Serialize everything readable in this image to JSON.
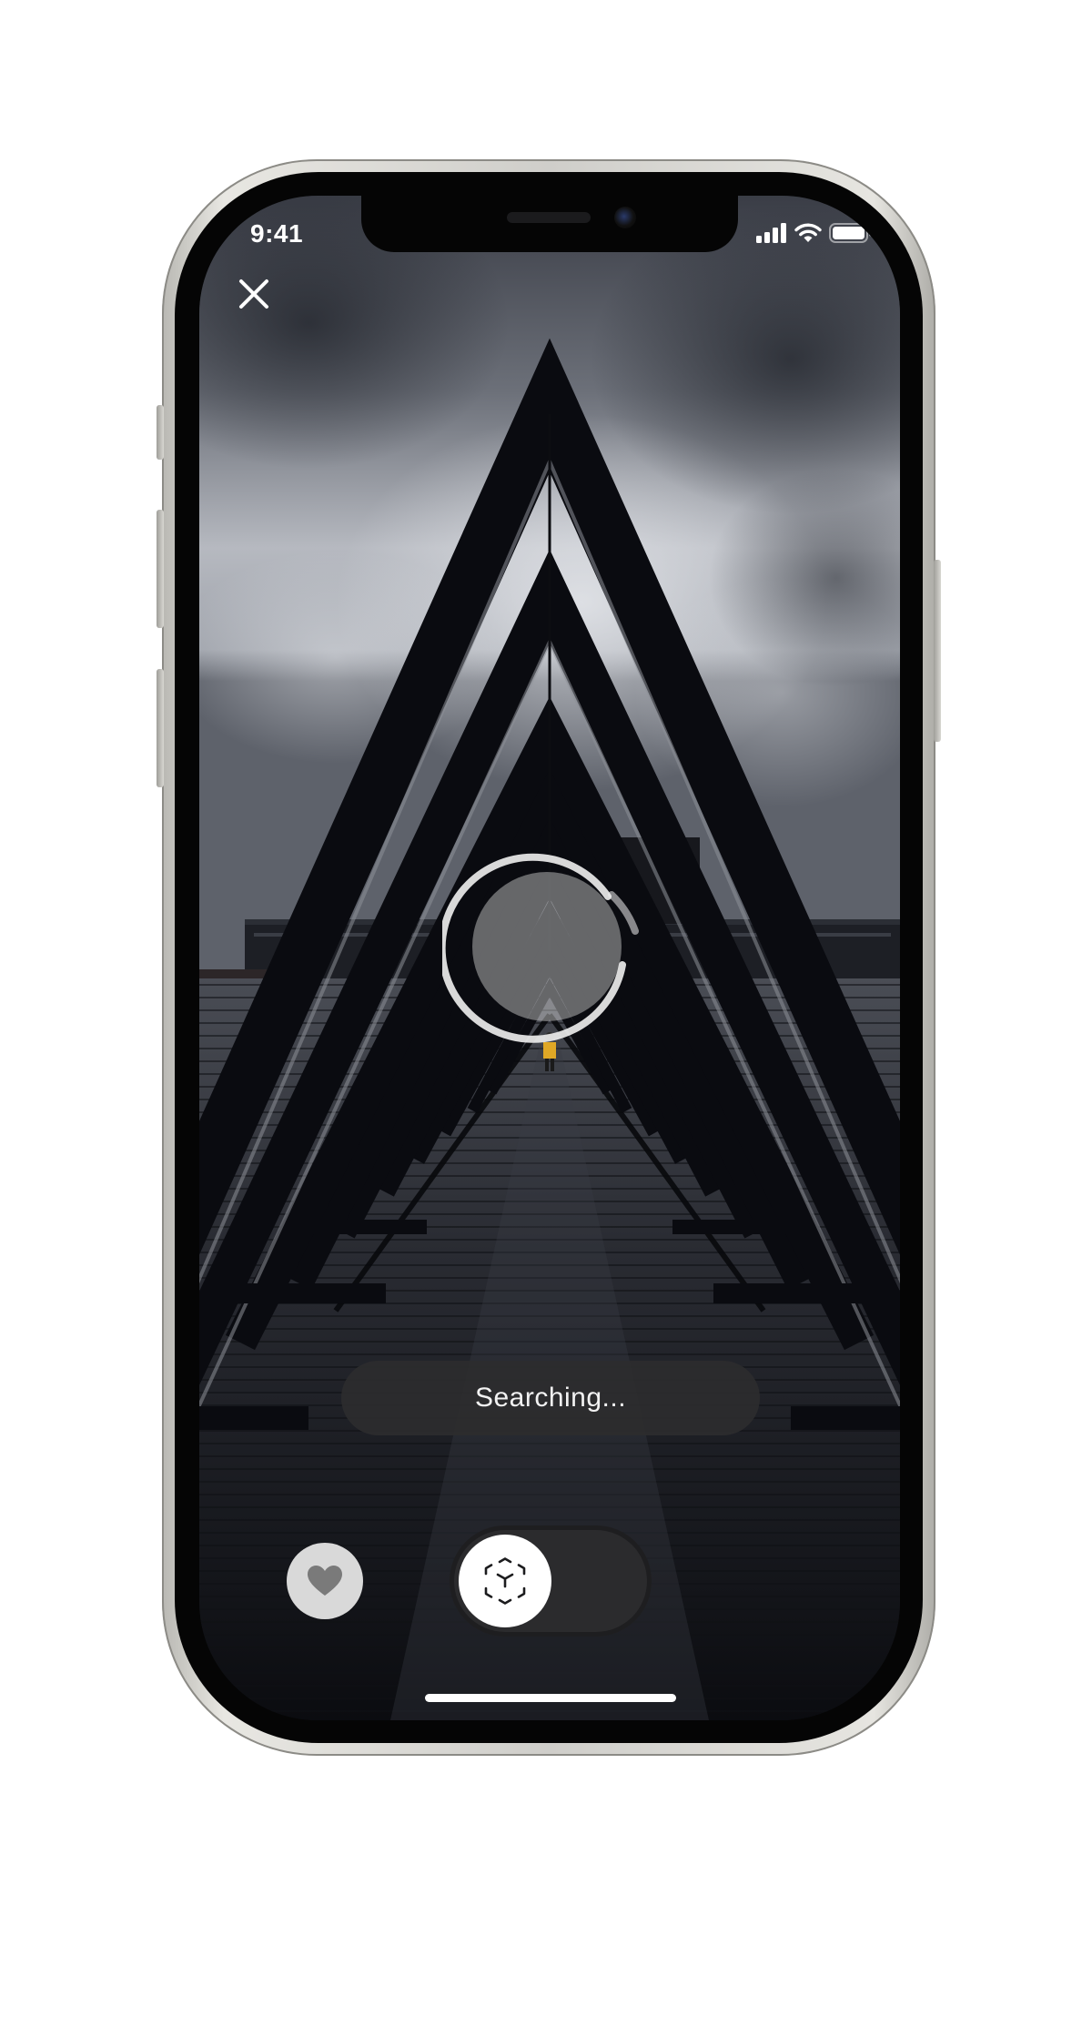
{
  "status_bar": {
    "time": "9:41",
    "icons": [
      "cellular-signal-icon",
      "wifi-icon",
      "battery-icon"
    ]
  },
  "top_bar": {
    "close_icon": "close-icon"
  },
  "scanner": {
    "status_label": "Searching...",
    "reticle_icon": "scan-reticle-icon"
  },
  "bottom_controls": {
    "favorite_icon": "heart-icon",
    "ar_mode_icon": "ar-cube-icon"
  },
  "colors": {
    "pill_background": "#2c2c2e",
    "accent_white": "#ffffff",
    "favorite_bg": "#d9d9d9"
  }
}
